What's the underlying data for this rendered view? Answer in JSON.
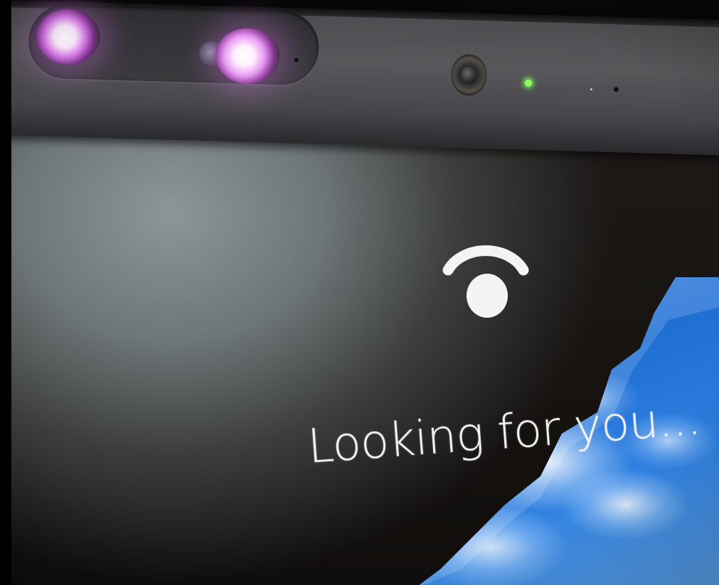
{
  "display": {
    "status_message": "Looking for you...",
    "recognition_icon": "face-recognition-icon",
    "text_color": "#f2f2f2"
  },
  "hardware": {
    "infrared_emitters": [
      "ir-emitter-left",
      "ir-emitter-right"
    ],
    "webcam_icon": "webcam-icon",
    "indicator_led_color": "#8bff5a"
  },
  "colors": {
    "bezel": "#4c4c4f",
    "ir_glow": "#d77de6",
    "sky_blue": "#1f6fd4"
  }
}
